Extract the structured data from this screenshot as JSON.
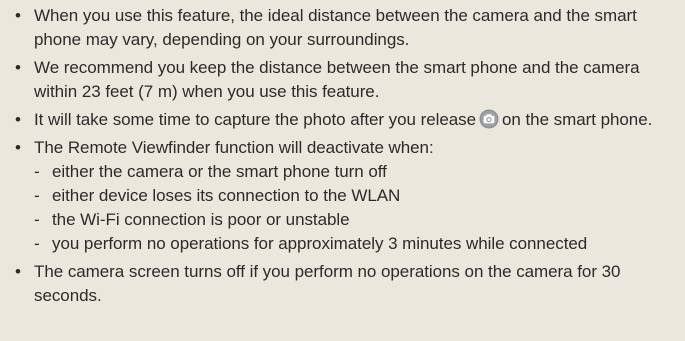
{
  "notes": [
    {
      "text": "When you use this feature, the ideal distance between the camera and the smart phone may vary, depending on your surroundings."
    },
    {
      "text": "We recommend you keep the distance between the smart phone and the camera within 23 feet (7 m) when you use this feature."
    },
    {
      "text_before_icon": "It will take some time to capture the photo after you release",
      "icon": "camera-shutter-icon",
      "text_after_icon": "on the smart phone."
    },
    {
      "text": "The Remote Viewfinder function will deactivate when:",
      "sub_items": [
        "either the camera or the smart phone turn off",
        "either device loses its connection to the WLAN",
        "the Wi-Fi connection is poor or unstable",
        "you perform no operations for approximately 3 minutes while connected"
      ]
    },
    {
      "text": "The camera screen turns off if you perform no operations on the camera for 30 seconds."
    }
  ],
  "bullet_symbol": "•",
  "dash_symbol": "-",
  "colors": {
    "background": "#ece7dc",
    "text": "#2b2b2b",
    "icon_outer": "#8a8f96",
    "icon_inner": "#ffffff"
  }
}
